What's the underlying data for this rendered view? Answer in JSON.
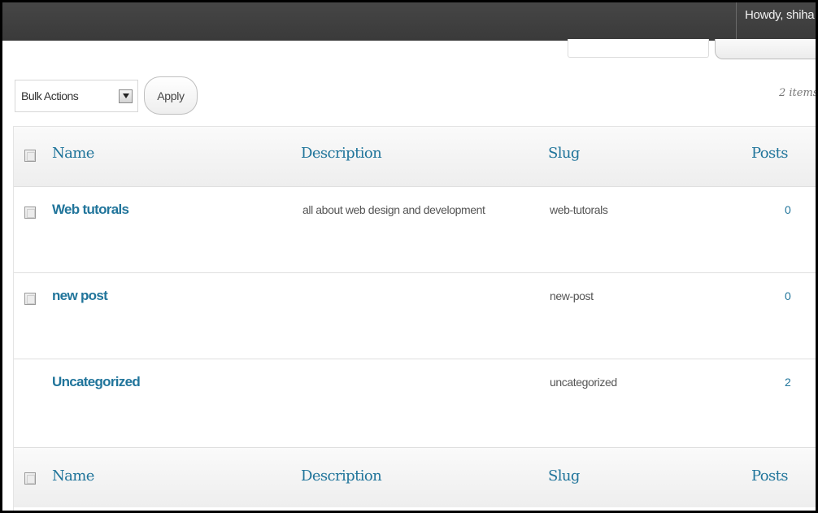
{
  "admin_bar": {
    "greeting": "Howdy, shiha"
  },
  "tablenav": {
    "bulk_actions_label": "Bulk Actions",
    "apply_label": "Apply",
    "items_count": "2 items"
  },
  "table": {
    "columns": {
      "name": "Name",
      "description": "Description",
      "slug": "Slug",
      "posts": "Posts"
    },
    "rows": [
      {
        "name": "Web tutorals",
        "description": "all about web design and development",
        "slug": "web-tutorals",
        "posts": "0",
        "has_checkbox": true
      },
      {
        "name": "new post",
        "description": "",
        "slug": "new-post",
        "posts": "0",
        "has_checkbox": true
      },
      {
        "name": "Uncategorized",
        "description": "",
        "slug": "uncategorized",
        "posts": "2",
        "has_checkbox": false
      }
    ]
  },
  "colors": {
    "link": "#21759b",
    "admin_bar": "#464646"
  }
}
